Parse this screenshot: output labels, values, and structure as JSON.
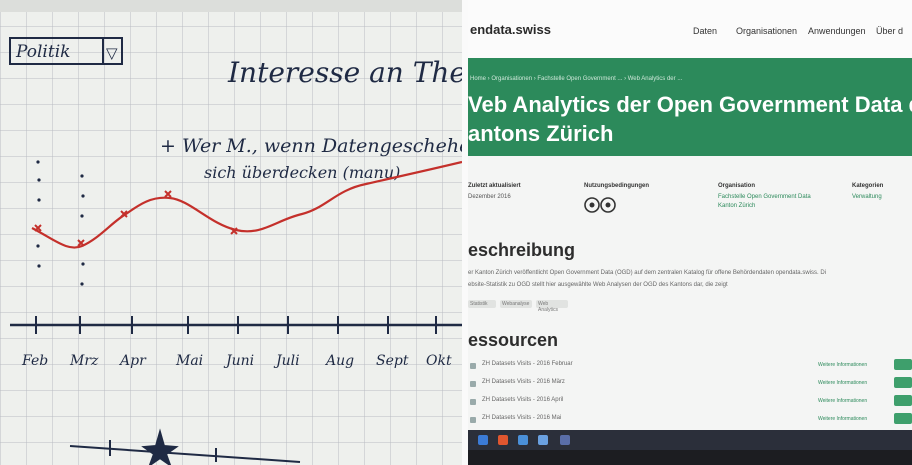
{
  "board": {
    "dropdown_label": "Politik",
    "dropdown_arrow": "▽",
    "header_text": "Interesse an Them",
    "annotation_line1": "+ Wer M., wenn Datengeschehen",
    "annotation_line2": "sich überdecken (manu)",
    "months": [
      "Feb",
      "Mrz",
      "Apr",
      "Mai",
      "Juni",
      "Juli",
      "Aug",
      "Sept",
      "Okt"
    ],
    "line_color": "#c4302b",
    "ink_color": "#1f2a44"
  },
  "site": {
    "logo": "endata.swiss",
    "nav": [
      "Daten",
      "Organisationen",
      "Anwendungen",
      "Über d"
    ],
    "breadcrumb": "Home › Organisationen › Fachstelle Open Government ... › Web Analytics der ...",
    "title_line1": "Veb Analytics der Open Government Data des",
    "title_line2": "antons Zürich",
    "meta": {
      "updated_label": "Zuletzt aktualisiert",
      "updated_value": "Dezember 2016",
      "terms_label": "Nutzungsbedingungen",
      "org_label": "Organisation",
      "org_value_1": "Fachstelle Open Government Data",
      "org_value_2": "Kanton Zürich",
      "cat_label": "Kategorien",
      "cat_value": "Verwaltung"
    },
    "description_heading": "eschreibung",
    "description_line1": "er Kanton Zürich veröffentlicht Open Government Data (OGD) auf dem zentralen Katalog für offene Behördendaten opendata.swiss. Di",
    "description_line2": "ebsite-Statistik zu OGD stellt hier ausgewählte Web Analysen der OGD des Kantons dar, die zeigt",
    "tags": [
      "Statistik",
      "Webanalyse",
      "Web Analytics"
    ],
    "resources_heading": "essourcen",
    "resources": [
      {
        "label": "ZH Datasets Visits - 2016 Februar",
        "link": "Weitere Informationen"
      },
      {
        "label": "ZH Datasets Visits - 2016 März",
        "link": "Weitere Informationen"
      },
      {
        "label": "ZH Datasets Visits - 2016 April",
        "link": "Weitere Informationen"
      },
      {
        "label": "ZH Datasets Visits - 2016 Mai",
        "link": "Weitere Informationen"
      }
    ],
    "accent": "#2c8a5b"
  }
}
